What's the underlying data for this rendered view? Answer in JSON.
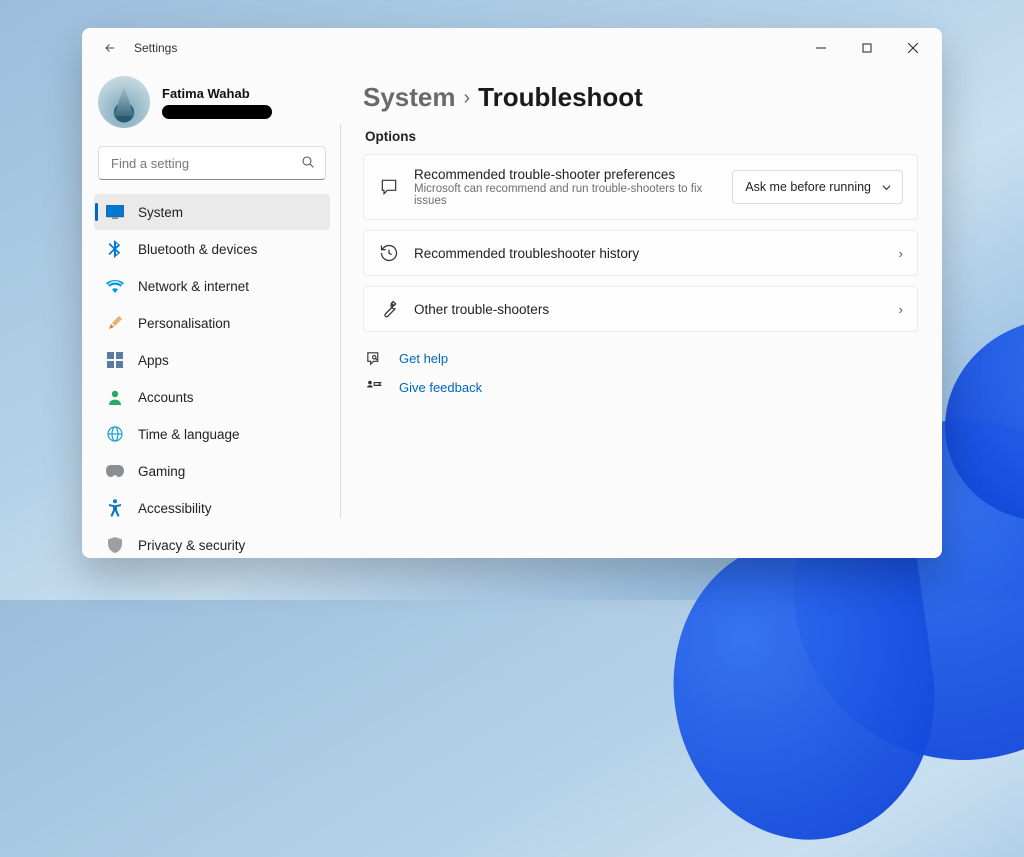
{
  "app_title": "Settings",
  "user": {
    "name": "Fatima Wahab"
  },
  "search": {
    "placeholder": "Find a setting"
  },
  "nav": {
    "items": [
      {
        "label": "System"
      },
      {
        "label": "Bluetooth & devices"
      },
      {
        "label": "Network & internet"
      },
      {
        "label": "Personalisation"
      },
      {
        "label": "Apps"
      },
      {
        "label": "Accounts"
      },
      {
        "label": "Time & language"
      },
      {
        "label": "Gaming"
      },
      {
        "label": "Accessibility"
      },
      {
        "label": "Privacy & security"
      }
    ]
  },
  "breadcrumb": {
    "parent": "System",
    "current": "Troubleshoot"
  },
  "section_label": "Options",
  "cards": {
    "pref": {
      "title": "Recommended trouble-shooter preferences",
      "subtitle": "Microsoft can recommend and run trouble-shooters to fix issues",
      "dropdown_value": "Ask me before running"
    },
    "history": {
      "title": "Recommended troubleshooter history"
    },
    "other": {
      "title": "Other trouble-shooters"
    }
  },
  "links": {
    "help": "Get help",
    "feedback": "Give feedback"
  }
}
